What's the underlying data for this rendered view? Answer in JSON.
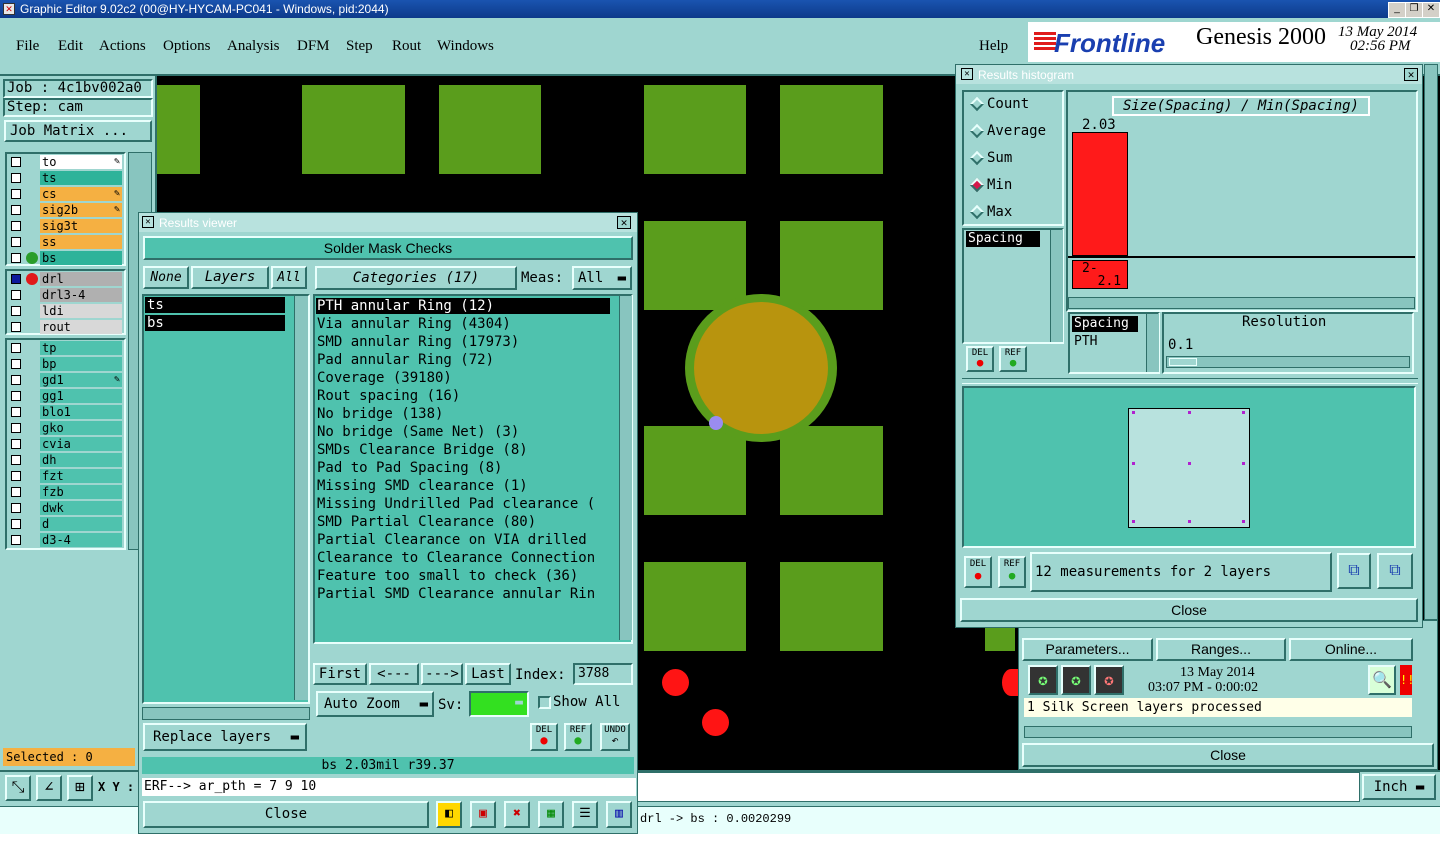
{
  "window_title": "Graphic Editor 9.02c2 (00@HY-HYCAM-PC041 - Windows, pid:2044)",
  "menu": [
    "File",
    "Edit",
    "Actions",
    "Options",
    "Analysis",
    "DFM",
    "Step",
    "Rout",
    "Windows"
  ],
  "help_label": "Help",
  "brand": {
    "logo": "Frontline",
    "product": "Genesis 2000",
    "date": "13 May 2014",
    "time": "02:56 PM"
  },
  "job": {
    "job_label": "Job : 4c1bv002a0",
    "step_label": "Step: cam",
    "matrix_button": "Job Matrix ..."
  },
  "layers_top": [
    {
      "name": "to",
      "bg": "#ffffff",
      "mark": true
    },
    {
      "name": "ts",
      "bg": "#2eb39a",
      "mark": false
    },
    {
      "name": "cs",
      "bg": "#f5b042",
      "mark": true
    },
    {
      "name": "sig2b",
      "bg": "#f5b042",
      "mark": true
    },
    {
      "name": "sig3t",
      "bg": "#f5b042",
      "mark": false
    },
    {
      "name": "ss",
      "bg": "#f5b042",
      "mark": false
    },
    {
      "name": "bs",
      "bg": "#2eb39a",
      "mark": false
    }
  ],
  "layers_mid": [
    {
      "name": "drl",
      "bg": "#b0b0b0"
    },
    {
      "name": "drl3-4",
      "bg": "#b0b0b0"
    },
    {
      "name": "ldi",
      "bg": "#d8d8d8"
    },
    {
      "name": "rout",
      "bg": "#d8d8d8"
    }
  ],
  "layers_bottom": [
    "tp",
    "bp",
    "gd1",
    "gg1",
    "blo1",
    "gko",
    "cvia",
    "dh",
    "fzt",
    "fzb",
    "dwk",
    "d",
    "d3-4"
  ],
  "selected_label": "Selected : 0",
  "xy_label": "X Y :",
  "results_viewer": {
    "title": "Results viewer",
    "heading": "Solder Mask Checks",
    "none_btn": "None",
    "layers_btn": "Layers",
    "all_btn": "All",
    "layer_items": [
      "ts",
      "bs"
    ],
    "categories_btn": "Categories (17)",
    "meas_label": "Meas:",
    "meas_value": "All",
    "categories": [
      "PTH annular Ring (12)",
      "Via annular Ring (4304)",
      "SMD annular Ring (17973)",
      "Pad annular Ring (72)",
      "Coverage (39180)",
      "Rout spacing (16)",
      "No bridge (138)",
      "No bridge (Same Net) (3)",
      "SMDs Clearance Bridge (8)",
      "Pad to Pad Spacing (8)",
      "Missing SMD clearance (1)",
      "Missing Undrilled Pad clearance (",
      "SMD Partial Clearance (80)",
      "Partial Clearance on VIA drilled",
      "Clearance to Clearance Connection",
      "Feature too small to check (36)",
      "Partial SMD Clearance annular Rin"
    ],
    "first_btn": "First",
    "prev_btn": "<---",
    "next_btn": "--->",
    "last_btn": "Last",
    "index_label": "Index:",
    "index_value": "3788",
    "auto_zoom": "Auto Zoom",
    "sv_label": "Sv:",
    "show_all": "Show All",
    "replace_layers": "Replace layers",
    "del": "DEL",
    "ref": "REF",
    "undo": "UNDO",
    "status": "bs 2.03mil  r39.37",
    "erf": "ERF--> ar_pth = 7 9 10",
    "close": "Close"
  },
  "histogram": {
    "title": "Results histogram",
    "options": [
      "Count",
      "Average",
      "Sum",
      "Min",
      "Max"
    ],
    "selected_option": "Min",
    "chart_title": "Size(Spacing) / Min(Spacing)",
    "bar_value": "2.03",
    "bucket_label": "2-\n  2.1",
    "list_item": "Spacing",
    "sub_head": "Spacing",
    "sub_item": "PTH",
    "resolution_label": "Resolution",
    "resolution_value": "0.1",
    "del": "DEL",
    "ref": "REF",
    "measurements": "12 measurements for 2 layers",
    "close": "Close",
    "accent": "#ff1a1a"
  },
  "analysis_panel": {
    "parameters": "Parameters...",
    "ranges": "Ranges...",
    "online": "Online...",
    "date": "13 May 2014",
    "time": "03:07 PM - 0:00:02",
    "processed": "1 Silk Screen layers processed",
    "close": "Close"
  },
  "units": "Inch",
  "bottom_status": "drl -> bs : 0.0020299"
}
